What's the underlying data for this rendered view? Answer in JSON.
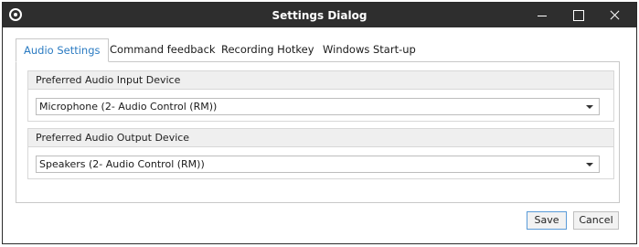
{
  "window": {
    "title": "Settings Dialog"
  },
  "tabs": [
    {
      "label": "Audio Settings",
      "active": true
    },
    {
      "label": "Command feedback",
      "active": false
    },
    {
      "label": "Recording Hotkey",
      "active": false
    },
    {
      "label": "Windows Start-up",
      "active": false
    }
  ],
  "audio": {
    "input": {
      "header": "Preferred Audio Input Device",
      "selected": "Microphone (2- Audio Control (RM))"
    },
    "output": {
      "header": "Preferred Audio Output Device",
      "selected": "Speakers (2- Audio Control (RM))"
    }
  },
  "footer": {
    "save_label": "Save",
    "cancel_label": "Cancel"
  },
  "colors": {
    "titlebar": "#2e2e2e",
    "active_tab_text": "#2b7bc2",
    "save_border": "#5a9bd8"
  }
}
